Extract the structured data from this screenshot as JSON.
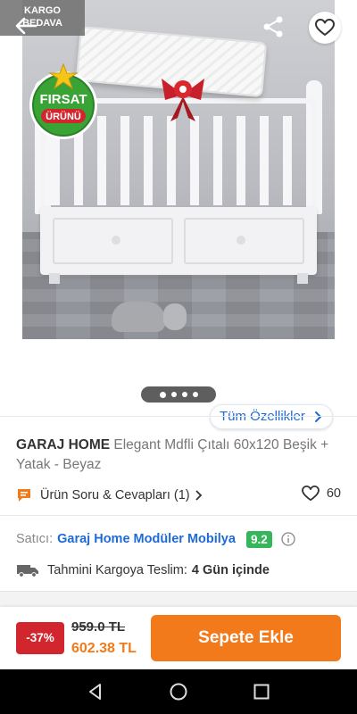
{
  "badges": {
    "kargo_line1": "KARGO",
    "kargo_line2": "BEDAVA",
    "firsat_line1": "FIRSAT",
    "firsat_line2": "ÜRÜNÜ"
  },
  "gallery": {
    "dot_count": 4,
    "active_index": 0
  },
  "all_features_label": "Tüm Özellikler",
  "product": {
    "brand": "GARAJ HOME",
    "name": "Elegant Mdfli Çıtalı 60x120 Beşik + Yatak - Beyaz"
  },
  "qa": {
    "label": "Ürün Soru & Cevapları (1)",
    "likes": "60"
  },
  "seller": {
    "label": "Satıcı:",
    "name": "Garaj Home Modüler Mobilya",
    "score": "9.2"
  },
  "shipping": {
    "label": "Tahmini Kargoya Teslim:",
    "value": "4 Gün içinde"
  },
  "pricing": {
    "discount": "-37%",
    "old_price": "959.0 TL",
    "new_price": "602.38 TL",
    "add_to_cart": "Sepete Ekle"
  },
  "colors": {
    "accent_orange": "#f27a1a",
    "link_blue": "#1e6ad8",
    "score_green": "#35b65a",
    "discount_red": "#d2262e"
  },
  "icons": [
    "back-arrow-icon",
    "share-icon",
    "heart-icon",
    "chat-icon",
    "chevron-right-icon",
    "info-icon",
    "truck-icon",
    "nav-back-icon",
    "nav-home-icon",
    "nav-recents-icon"
  ]
}
